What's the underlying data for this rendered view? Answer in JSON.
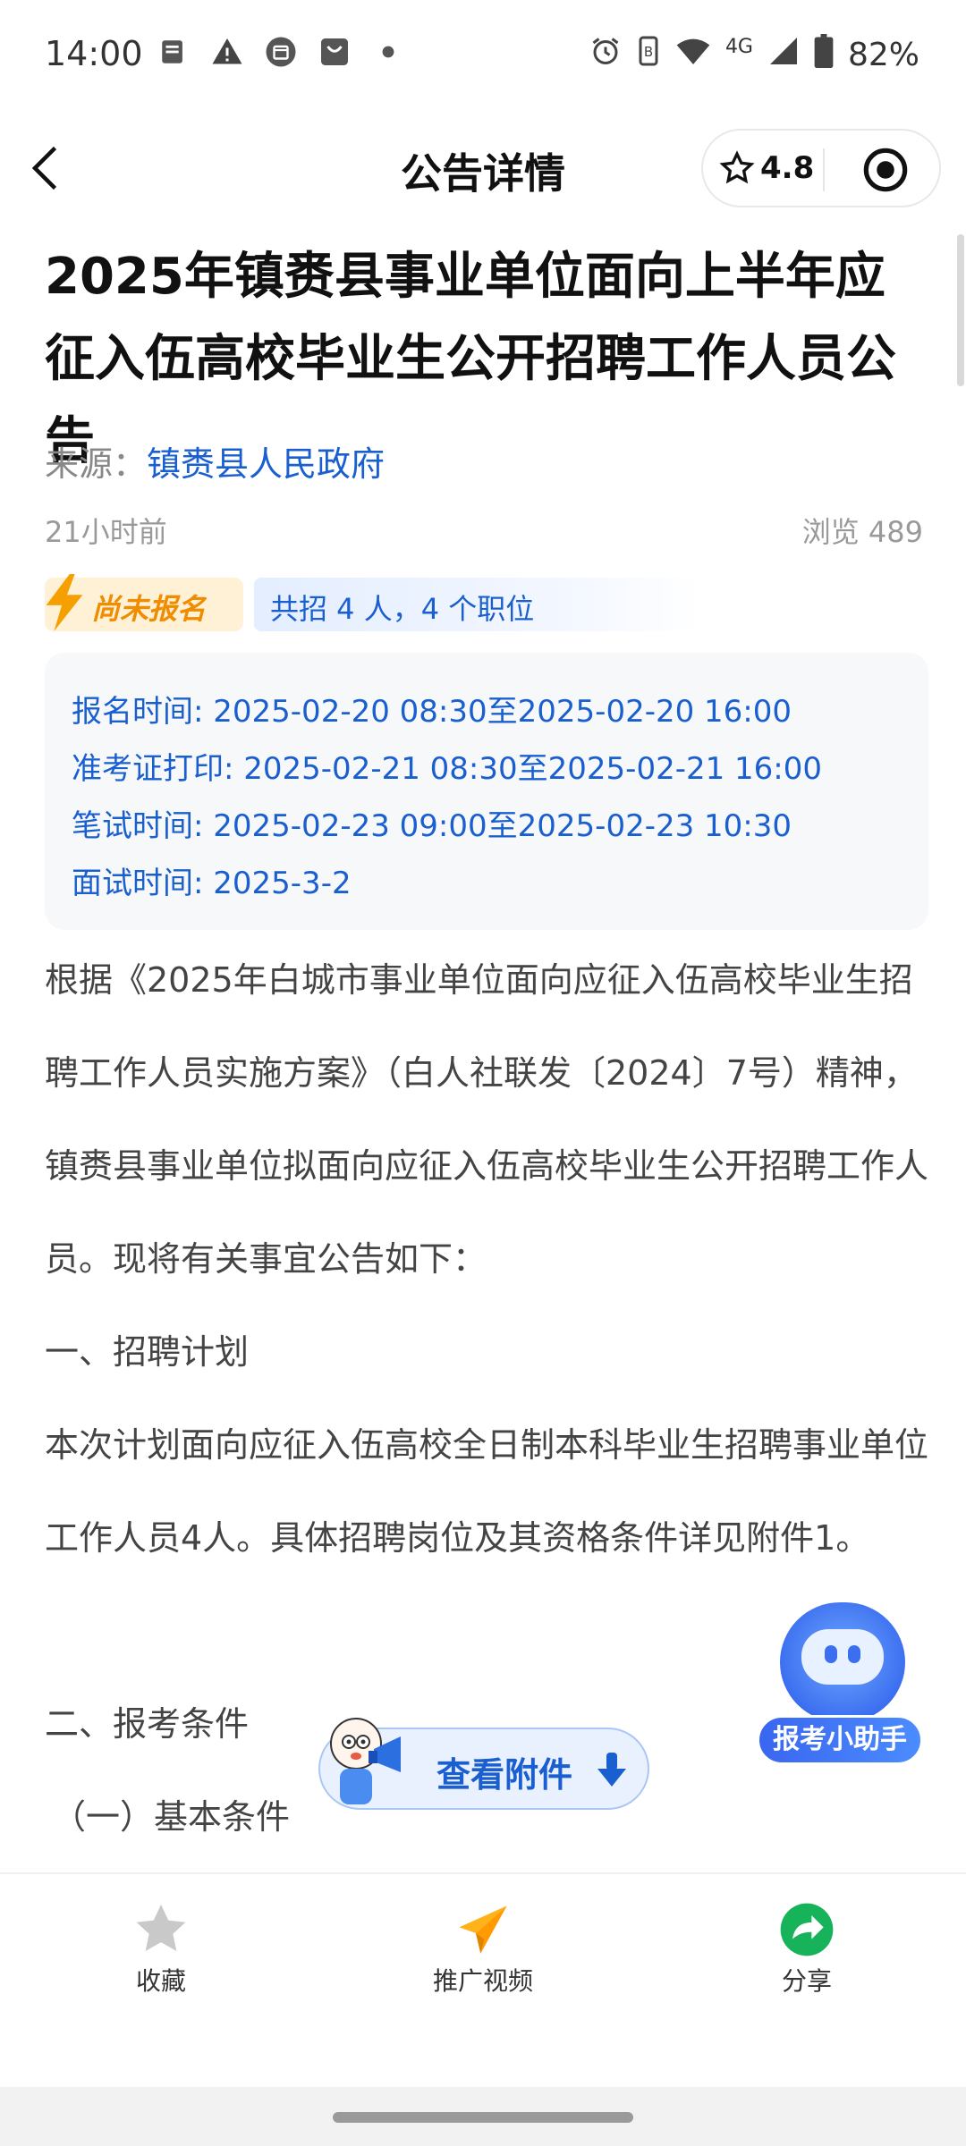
{
  "status_bar": {
    "time": "14:00",
    "network": "4G",
    "battery": "82%"
  },
  "header": {
    "title": "公告详情",
    "rating": "4.8"
  },
  "article": {
    "title": "2025年镇赉县事业单位面向上半年应征入伍高校毕业生公开招聘工作人员公告",
    "source_label": "来源：",
    "source_name": "镇赉县人民政府",
    "time_ago": "21小时前",
    "views": "浏览 489",
    "status_badge": "尚未报名",
    "recruit_summary": "共招 4 人，4 个职位",
    "timeline": [
      "报名时间: 2025-02-20 08:30至2025-02-20 16:00",
      "准考证打印: 2025-02-21 08:30至2025-02-21 16:00",
      "笔试时间: 2025-02-23 09:00至2025-02-23 10:30",
      "面试时间: 2025-3-2"
    ],
    "paragraphs": [
      "根据《2025年白城市事业单位面向应征入伍高校毕业生招聘工作人员实施方案》（白人社联发〔2024〕7号）精神，镇赉县事业单位拟面向应征入伍高校毕业生公开招聘工作人员。现将有关事宜公告如下：",
      "一、招聘计划",
      "本次计划面向应征入伍高校全日制本科毕业生招聘事业单位工作人员4人。具体招聘岗位及其资格条件详见附件1。",
      "二、报考条件",
      "（一）基本条件"
    ]
  },
  "floating": {
    "assistant_label": "报考小助手",
    "attachment_label": "查看附件"
  },
  "bottom_tabs": [
    {
      "label": "收藏",
      "icon": "star-icon"
    },
    {
      "label": "推广视频",
      "icon": "paper-plane-icon"
    },
    {
      "label": "分享",
      "icon": "share-icon"
    }
  ],
  "colors": {
    "link_blue": "#1a5fd0",
    "badge_orange": "#f08c00",
    "share_green": "#17b35a"
  }
}
